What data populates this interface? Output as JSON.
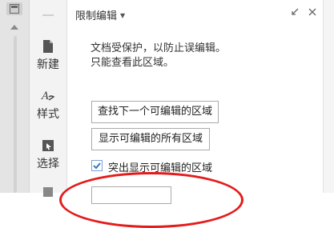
{
  "rail": {
    "items": [
      {
        "label": "新建",
        "icon": "new-document-icon"
      },
      {
        "label": "样式",
        "icon": "style-icon"
      },
      {
        "label": "选择",
        "icon": "select-icon"
      }
    ]
  },
  "panel": {
    "title": "限制编辑",
    "description_line1": "文档受保护，以防止误编辑。",
    "description_line2": "只能查看此区域。",
    "find_next_button": "查找下一个可编辑的区域",
    "show_all_button": "显示可编辑的所有区域",
    "highlight_checkbox": {
      "label": "突出显示可编辑的区域",
      "checked": true
    }
  },
  "colors": {
    "accent": "#2b6cc4",
    "annotation": "#e41b1b"
  }
}
